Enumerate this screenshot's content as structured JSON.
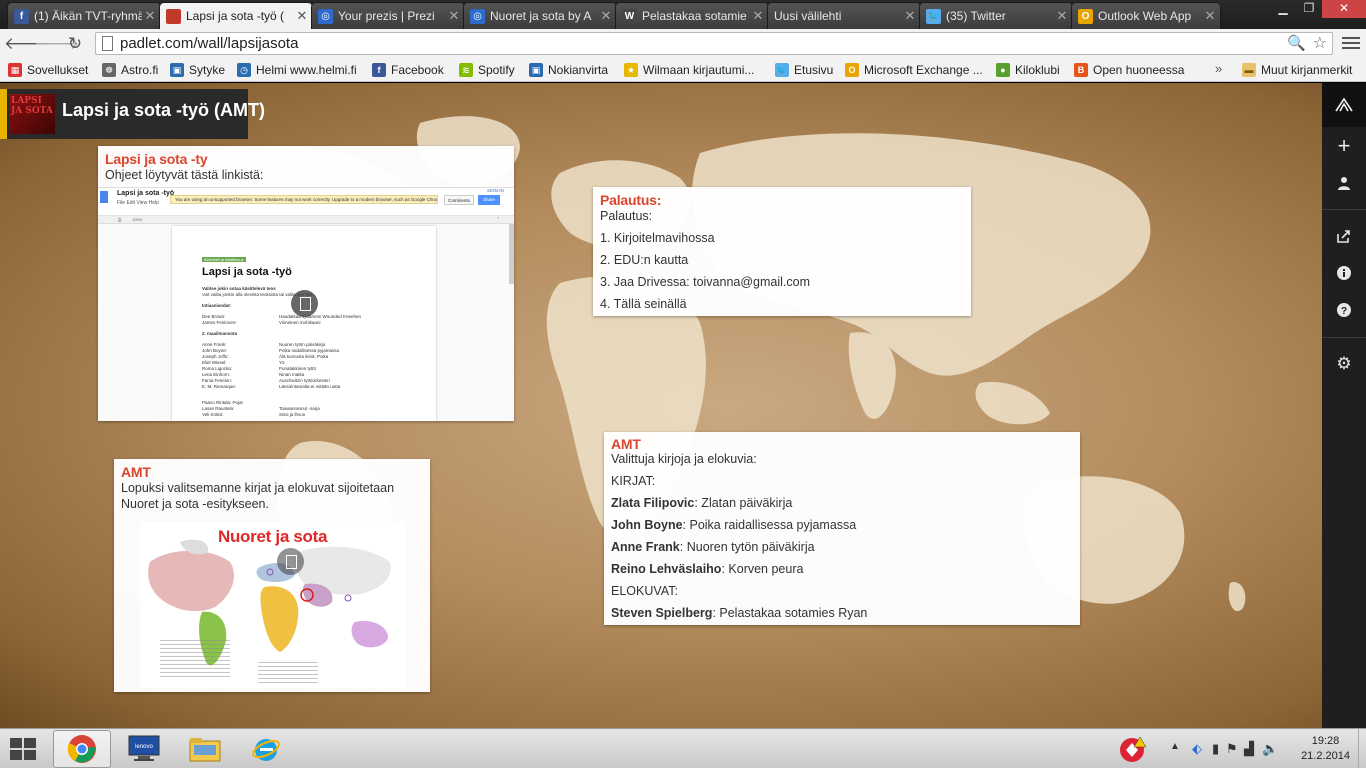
{
  "tabs": [
    {
      "title": "(1) Äikän TVT-ryhmä",
      "color": "#3b5998",
      "glyph": "f",
      "active": false
    },
    {
      "title": "Lapsi ja sota -työ (",
      "color": "#c0392b",
      "glyph": "",
      "active": true
    },
    {
      "title": "Your prezis | Prezi",
      "color": "#2d6bcf",
      "glyph": "◎",
      "active": false
    },
    {
      "title": "Nuoret ja sota by A",
      "color": "#2d6bcf",
      "glyph": "◎",
      "active": false
    },
    {
      "title": "Pelastakaa sotamie",
      "color": "#444444",
      "glyph": "W",
      "active": false
    },
    {
      "title": "Uusi välilehti",
      "color": "",
      "glyph": "",
      "active": false
    },
    {
      "title": "(35) Twitter",
      "color": "#55acee",
      "glyph": "🐦",
      "active": false
    },
    {
      "title": "Outlook Web App",
      "color": "#e8a400",
      "glyph": "O",
      "active": false
    }
  ],
  "toolbar": {
    "url": "padlet.com/wall/lapsijasota"
  },
  "bookmarks": [
    {
      "label": "Sovellukset",
      "color": "#d33",
      "glyph": "▦"
    },
    {
      "label": "Astro.fi",
      "color": "#666",
      "glyph": "☸"
    },
    {
      "label": "Sytyke",
      "color": "#2b6cb0",
      "glyph": "▣"
    },
    {
      "label": "Helmi www.helmi.fi",
      "color": "#2b6cb0",
      "glyph": "◷"
    },
    {
      "label": "Facebook",
      "color": "#3b5998",
      "glyph": "f"
    },
    {
      "label": "Spotify",
      "color": "#84bd00",
      "glyph": "≋"
    },
    {
      "label": "Nokianvirta",
      "color": "#2b6cb0",
      "glyph": "▣"
    },
    {
      "label": "Wilmaan kirjautumi...",
      "color": "#e6b800",
      "glyph": "★"
    },
    {
      "label": "Etusivu",
      "color": "#55acee",
      "glyph": "🐦"
    },
    {
      "label": "Microsoft Exchange ...",
      "color": "#e8a400",
      "glyph": "O"
    },
    {
      "label": "Kiloklubi",
      "color": "#5aa02c",
      "glyph": "●"
    },
    {
      "label": "Open huoneessa",
      "color": "#e8551b",
      "glyph": "B"
    }
  ],
  "bookmarks_other": "Muut kirjanmerkit",
  "wall": {
    "title": "Lapsi ja sota -työ (AMT)",
    "thumb_text": "LAPSI JA SOTA"
  },
  "posts": {
    "doc": {
      "title": "Lapsi ja sota -ty",
      "body": "Ohjeet löytyvät tästä linkistä:",
      "preview": {
        "name": "Lapsi ja sota -työ",
        "menu": "File   Edit   View   Help",
        "warning": "You are using an unsupported browser. Some features may not work correctly. Upgrade to a modern browser, such as Google Chrome.  Dismiss",
        "comments": "Comments",
        "share": "Share",
        "signin": "SIGN IN",
        "zoom": "100%",
        "tag": "Äidinkieli ja kirjallisuus",
        "heading": "Lapsi ja sota -työ",
        "lines": [
          {
            "a": "Valitse jokin sotaa käsittelevä teos",
            "b": "",
            "bold": true
          },
          {
            "a": "Voit valita jonkin alla olevista teoksista tai valita sen itse.",
            "b": "",
            "bold": false
          },
          {
            "a": "",
            "b": "",
            "gap": true
          },
          {
            "a": "Intiaanisodat:",
            "b": "",
            "bold": true
          },
          {
            "a": "",
            "b": "",
            "gap": true
          },
          {
            "a": "Dee Brown:",
            "b": "Haudatkaa sydämeni Wounded Kneehen",
            "bold": false
          },
          {
            "a": "James Fenimore:",
            "b": "Viimeinen mohikaani",
            "bold": false
          },
          {
            "a": "",
            "b": "",
            "gap": true
          },
          {
            "a": "2. maailmansota",
            "b": "",
            "bold": true
          },
          {
            "a": "",
            "b": "",
            "gap": true
          },
          {
            "a": "Anne Frank:",
            "b": "Nuoren tytön päiväkirja",
            "bold": false
          },
          {
            "a": "John Boyne:",
            "b": "Poika raidallisessa pyjamassa",
            "bold": false
          },
          {
            "a": "Joseph Joffo:",
            "b": "Älä tunnusta ikinä, Poika",
            "bold": false
          },
          {
            "a": "Eliel Wiesel:",
            "b": "Yö",
            "bold": false
          },
          {
            "a": "Roma Ligocka:",
            "b": "Punatakkinen tyttö",
            "bold": false
          },
          {
            "a": "Lena Einhorn:",
            "b": "Ninan matka",
            "bold": false
          },
          {
            "a": "Fania Fenelon:",
            "b": "Auschwitzin tyttöorkesteri",
            "bold": false
          },
          {
            "a": "E. M. Remarque:",
            "b": "Länsirintamalta ei mitään uutta",
            "bold": false
          },
          {
            "a": "",
            "b": "",
            "gap": true
          },
          {
            "a": "",
            "b": "",
            "gap": true
          },
          {
            "a": "Paavo Rintala: Pojat",
            "b": "",
            "bold": false
          },
          {
            "a": "Lasse Raustela:",
            "b": "Taivaanrannut -sarja",
            "bold": false
          },
          {
            "a": "Veli Kräkö:",
            "b": "Sissi ja lhvun",
            "bold": false
          }
        ]
      }
    },
    "palautus": {
      "title": "Palautus:",
      "lines": [
        "Palautus:",
        "1. Kirjoitelmavihossa",
        "2. EDU:n kautta",
        "3. Jaa Drivessa: toivanna@gmail.com",
        "4. Tällä seinällä"
      ]
    },
    "amt_map": {
      "title": "AMT",
      "body": "Lopuksi valitsemanne kirjat ja elokuvat sijoitetaan Nuoret ja sota -esitykseen.",
      "image_title": "Nuoret ja sota"
    },
    "amt_list": {
      "title": "AMT",
      "intro": "Valittuja kirjoja ja elokuvia:",
      "books_header": "KIRJAT:",
      "books": [
        {
          "author": "Zlata Filipovic",
          "work": ": Zlatan päiväkirja"
        },
        {
          "author": "John Boyne",
          "work": ": Poika raidallisessa pyjamassa"
        },
        {
          "author": "Anne Frank",
          "work": ": Nuoren tytön päiväkirja"
        },
        {
          "author": "Reino Lehväslaiho",
          "work": ": Korven peura"
        }
      ],
      "movies_header": "ELOKUVAT:",
      "movies": [
        {
          "author": "Steven Spielberg",
          "work": ": Pelastakaa sotamies Ryan"
        }
      ]
    }
  },
  "taskbar": {
    "time": "19:28",
    "date": "21.2.2014"
  }
}
